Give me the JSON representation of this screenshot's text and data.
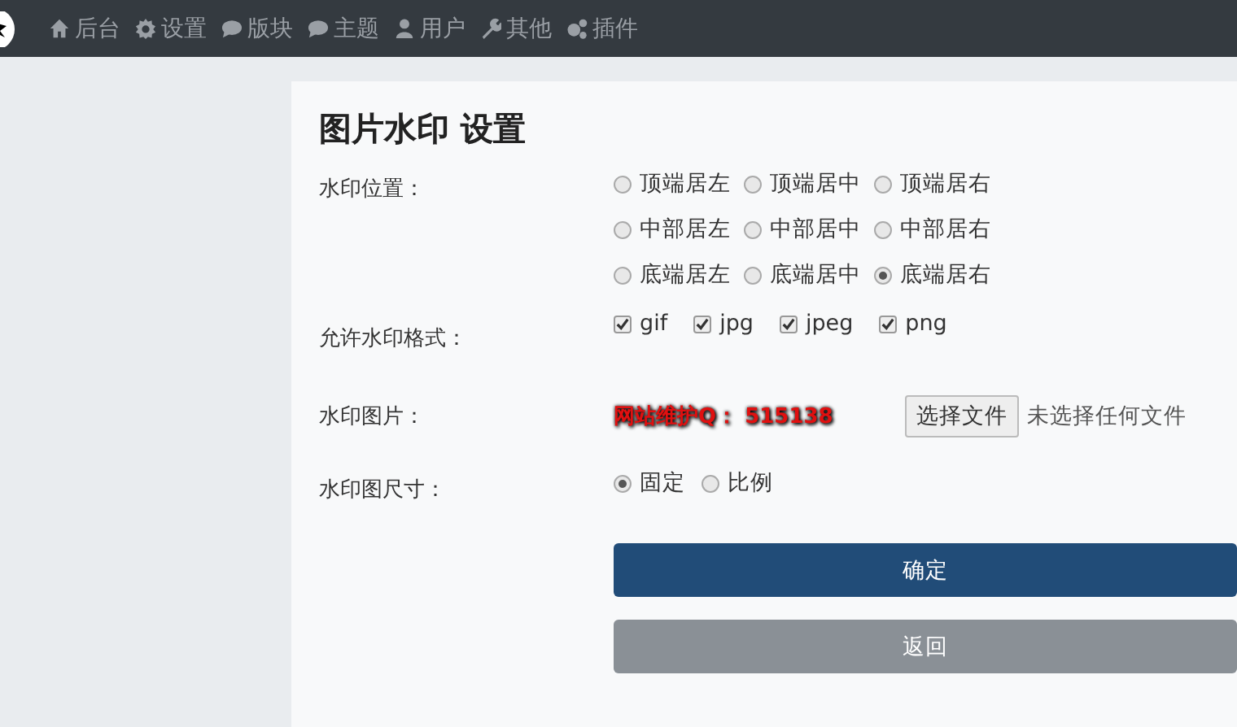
{
  "nav": {
    "items": [
      {
        "label": "后台"
      },
      {
        "label": "设置"
      },
      {
        "label": "版块"
      },
      {
        "label": "主题"
      },
      {
        "label": "用户"
      },
      {
        "label": "其他"
      },
      {
        "label": "插件"
      }
    ]
  },
  "title": "图片水印 设置",
  "fields": [
    {
      "kind": "radio",
      "label": "水印位置：",
      "options": [
        {
          "label": "顶端居左",
          "selected": false
        },
        {
          "label": "顶端居中",
          "selected": false
        },
        {
          "label": "顶端居右",
          "selected": false
        },
        {
          "label": "中部居左",
          "selected": false
        },
        {
          "label": "中部居中",
          "selected": false
        },
        {
          "label": "中部居右",
          "selected": false
        },
        {
          "label": "底端居左",
          "selected": false
        },
        {
          "label": "底端居中",
          "selected": false
        },
        {
          "label": "底端居右",
          "selected": true
        }
      ]
    },
    {
      "kind": "checkbox",
      "label": "允许水印格式：",
      "options": [
        {
          "label": "gif",
          "checked": true
        },
        {
          "label": "jpg",
          "checked": true
        },
        {
          "label": "jpeg",
          "checked": true
        },
        {
          "label": "png",
          "checked": true
        }
      ]
    },
    {
      "kind": "file",
      "label": "水印图片：",
      "preview": "网站维护Q： 515138",
      "button": "选择文件",
      "status": "未选择任何文件"
    },
    {
      "kind": "radio",
      "label": "水印图尺寸：",
      "options": [
        {
          "label": "固定",
          "selected": true
        },
        {
          "label": "比例",
          "selected": false
        }
      ]
    }
  ],
  "buttons": [
    {
      "label": "确定",
      "kind": "primary"
    },
    {
      "label": "返回",
      "kind": "secondary"
    }
  ]
}
